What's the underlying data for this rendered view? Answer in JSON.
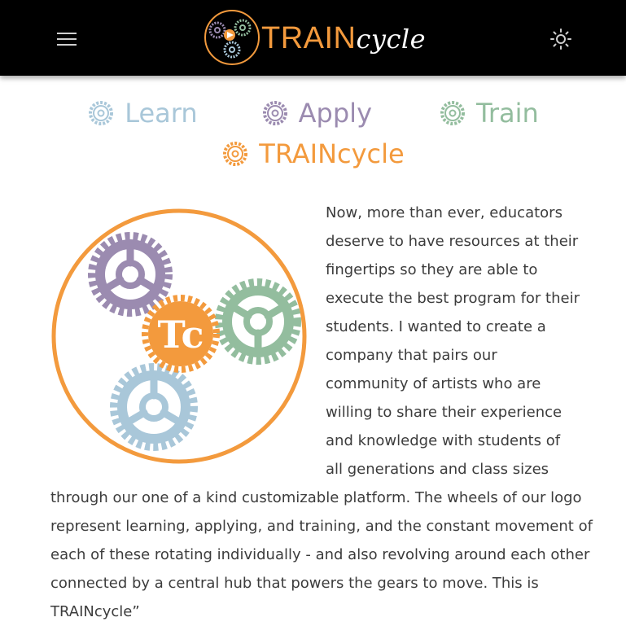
{
  "header": {
    "brand_train": "TRAIN",
    "brand_cycle": "cycle",
    "menu_icon": "hamburger-icon",
    "theme_icon": "sun-icon"
  },
  "nav": {
    "items": [
      {
        "label": "Learn",
        "color": "#a9c7d9",
        "icon": "gear-icon"
      },
      {
        "label": "Apply",
        "color": "#9b8bb0",
        "icon": "gear-icon"
      },
      {
        "label": "Train",
        "color": "#93bd9e",
        "icon": "gear-icon"
      },
      {
        "label": "TRAINcycle",
        "color": "#f39a3d",
        "icon": "gear-icon"
      }
    ]
  },
  "content": {
    "hero_logo_text": "Tc",
    "wrapped_lines": [
      "Now, more than ever, educators",
      "deserve to have resources at their",
      "fingertips so they are able to",
      "execute the best program for their",
      "students. I wanted to create a",
      "company that pairs our",
      "community of artists who are",
      "willing to share their experience",
      "and knowledge with students of",
      "all generations and class sizes"
    ],
    "full_lines": [
      "through our one of a kind customizable platform. The wheels of our logo",
      "represent learning, applying, and training, and the constant movement of",
      "each of these rotating individually - and also revolving around each other",
      "connected by a central hub that powers the gears to move. This is",
      "TRAINcycle”"
    ]
  },
  "colors": {
    "orange": "#f39a3d",
    "purple": "#9b8bb0",
    "green": "#93bd9e",
    "blue": "#a9c7d9",
    "text": "#3c3c3c",
    "header_bg": "#000000"
  }
}
